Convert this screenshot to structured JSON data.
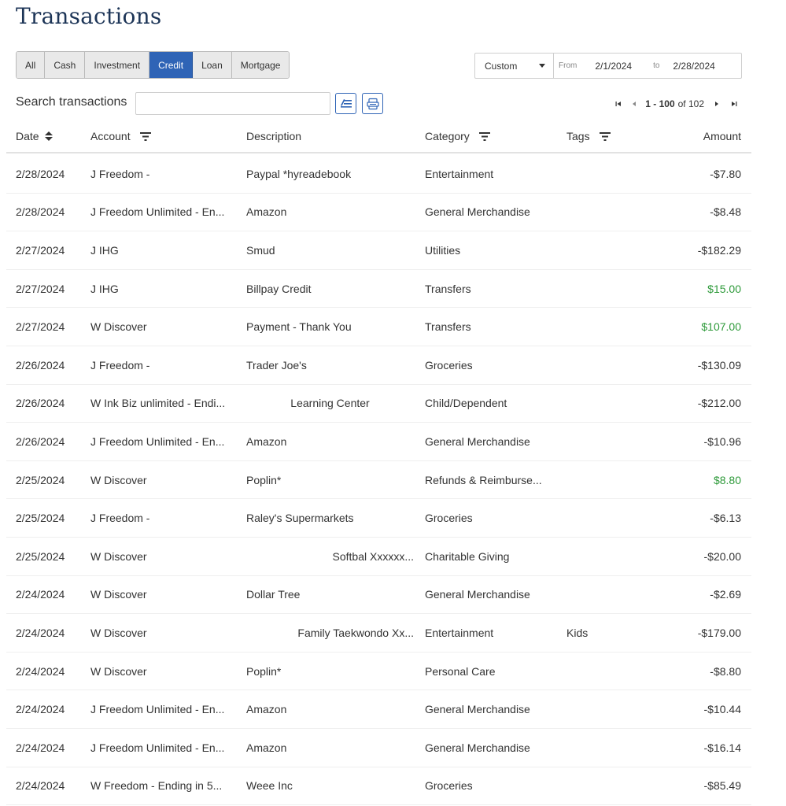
{
  "page_title": "Transactions",
  "account_type_tabs": [
    {
      "label": "All",
      "active": false
    },
    {
      "label": "Cash",
      "active": false
    },
    {
      "label": "Investment",
      "active": false
    },
    {
      "label": "Credit",
      "active": true
    },
    {
      "label": "Loan",
      "active": false
    },
    {
      "label": "Mortgage",
      "active": false
    }
  ],
  "date_range": {
    "preset": "Custom",
    "from_label": "From",
    "from_value": "2/1/2024",
    "to_label": "to",
    "to_value": "2/28/2024"
  },
  "search": {
    "label": "Search transactions",
    "value": "",
    "placeholder": ""
  },
  "toolbar_icons": [
    "edit-list-icon",
    "export-csv-icon"
  ],
  "pagination": {
    "range": "1 - 100",
    "of_text": "of 102"
  },
  "columns": {
    "date": "Date",
    "account": "Account",
    "description": "Description",
    "category": "Category",
    "tags": "Tags",
    "amount": "Amount"
  },
  "colors": {
    "accent": "#2f64b6",
    "title": "#1d3557",
    "positive_amount": "#2e9a3a"
  },
  "transactions": [
    {
      "date": "2/28/2024",
      "account": "J Freedom -",
      "description": "Paypal *hyreadebook",
      "category": "Entertainment",
      "tags": "",
      "amount": "-$7.80",
      "positive": false
    },
    {
      "date": "2/28/2024",
      "account": "J Freedom Unlimited - En...",
      "description": "Amazon",
      "category": "General Merchandise",
      "tags": "",
      "amount": "-$8.48",
      "positive": false
    },
    {
      "date": "2/27/2024",
      "account": "J IHG",
      "description": "Smud",
      "category": "Utilities",
      "tags": "",
      "amount": "-$182.29",
      "positive": false
    },
    {
      "date": "2/27/2024",
      "account": "J IHG",
      "description": "Billpay Credit",
      "category": "Transfers",
      "tags": "",
      "amount": "$15.00",
      "positive": true
    },
    {
      "date": "2/27/2024",
      "account": "W Discover",
      "description": "Payment - Thank You",
      "category": "Transfers",
      "tags": "",
      "amount": "$107.00",
      "positive": true
    },
    {
      "date": "2/26/2024",
      "account": "J Freedom -",
      "description": "Trader Joe's",
      "category": "Groceries",
      "tags": "",
      "amount": "-$130.09",
      "positive": false
    },
    {
      "date": "2/26/2024",
      "account": "W Ink Biz unlimited - Endi...",
      "description": "Learning Center",
      "category": "Child/Dependent",
      "tags": "",
      "amount": "-$212.00",
      "positive": false
    },
    {
      "date": "2/26/2024",
      "account": "J Freedom Unlimited - En...",
      "description": "Amazon",
      "category": "General Merchandise",
      "tags": "",
      "amount": "-$10.96",
      "positive": false
    },
    {
      "date": "2/25/2024",
      "account": "W Discover",
      "description": "Poplin*",
      "category": "Refunds & Reimburse...",
      "tags": "",
      "amount": "$8.80",
      "positive": true
    },
    {
      "date": "2/25/2024",
      "account": "J Freedom -",
      "description": "Raley's Supermarkets",
      "category": "Groceries",
      "tags": "",
      "amount": "-$6.13",
      "positive": false
    },
    {
      "date": "2/25/2024",
      "account": "W Discover",
      "description": "Softbal Xxxxxx...",
      "category": "Charitable Giving",
      "tags": "",
      "amount": "-$20.00",
      "positive": false
    },
    {
      "date": "2/24/2024",
      "account": "W Discover",
      "description": "Dollar Tree",
      "category": "General Merchandise",
      "tags": "",
      "amount": "-$2.69",
      "positive": false
    },
    {
      "date": "2/24/2024",
      "account": "W Discover",
      "description": "Family Taekwondo Xx...",
      "category": "Entertainment",
      "tags": "Kids",
      "amount": "-$179.00",
      "positive": false
    },
    {
      "date": "2/24/2024",
      "account": "W Discover",
      "description": "Poplin*",
      "category": "Personal Care",
      "tags": "",
      "amount": "-$8.80",
      "positive": false
    },
    {
      "date": "2/24/2024",
      "account": "J Freedom Unlimited - En...",
      "description": "Amazon",
      "category": "General Merchandise",
      "tags": "",
      "amount": "-$10.44",
      "positive": false
    },
    {
      "date": "2/24/2024",
      "account": "J Freedom Unlimited - En...",
      "description": "Amazon",
      "category": "General Merchandise",
      "tags": "",
      "amount": "-$16.14",
      "positive": false
    },
    {
      "date": "2/24/2024",
      "account": "W Freedom - Ending in 5...",
      "description": "Weee Inc",
      "category": "Groceries",
      "tags": "",
      "amount": "-$85.49",
      "positive": false
    }
  ]
}
